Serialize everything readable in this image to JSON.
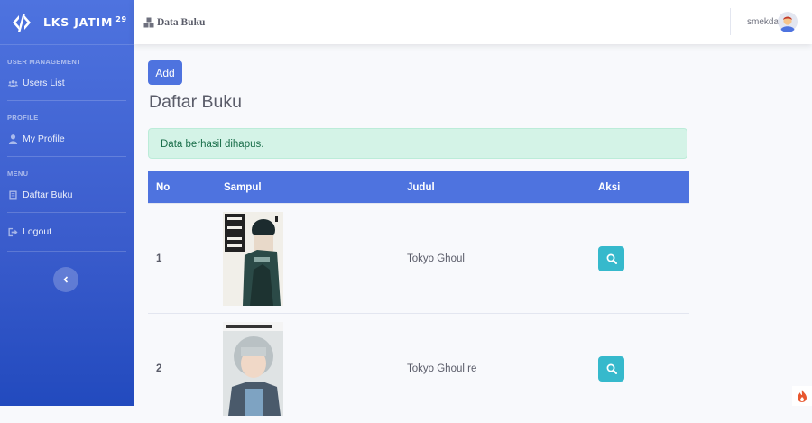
{
  "brand": {
    "name": "LKS JATIM",
    "superscript": "29"
  },
  "sidebar": {
    "sections": [
      {
        "heading": "USER MANAGEMENT",
        "item": "Users List",
        "icon": "users-icon"
      },
      {
        "heading": "PROFILE",
        "item": "My Profile",
        "icon": "user-icon"
      },
      {
        "heading": "MENU",
        "item": "Daftar Buku",
        "icon": "book-icon"
      }
    ],
    "logout": "Logout"
  },
  "topbar": {
    "page": "Data Buku",
    "username": "smekda"
  },
  "main": {
    "add_label": "Add",
    "title": "Daftar Buku",
    "alert": "Data berhasil dihapus."
  },
  "table": {
    "headers": [
      "No",
      "Sampul",
      "Judul",
      "Aksi"
    ],
    "rows": [
      {
        "no": "1",
        "judul": "Tokyo Ghoul"
      },
      {
        "no": "2",
        "judul": "Tokyo Ghoul re"
      }
    ]
  },
  "colors": {
    "primary": "#4e73df",
    "info": "#36b9cc",
    "success_bg": "#d4f3e7"
  }
}
